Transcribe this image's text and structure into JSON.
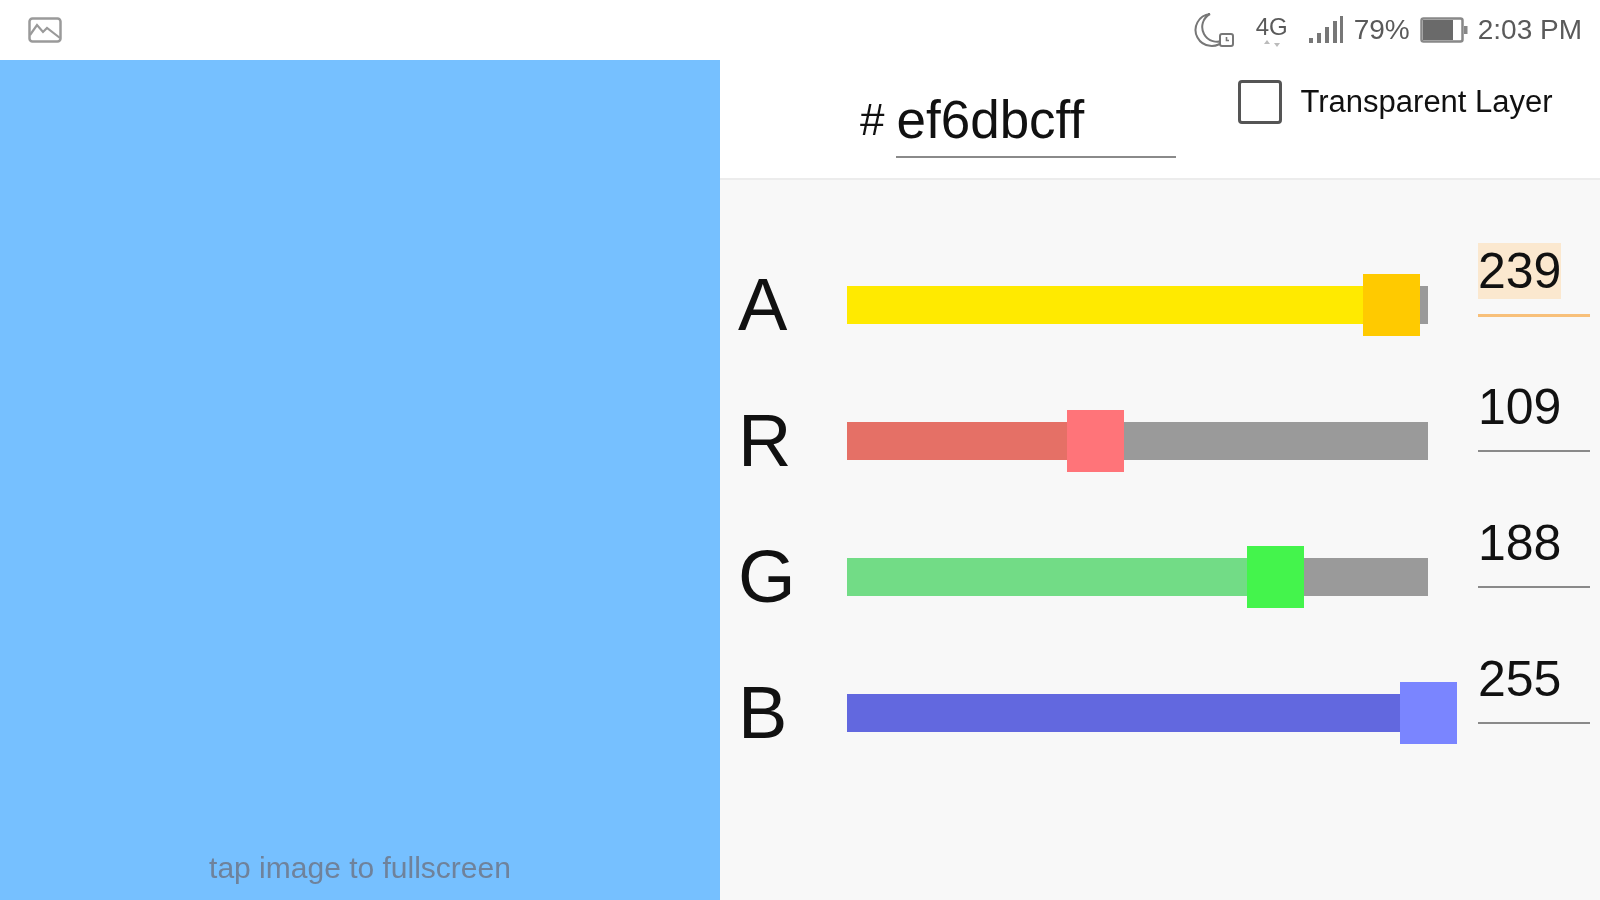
{
  "status_bar": {
    "network": "4G",
    "battery": "79%",
    "time": "2:03 PM"
  },
  "preview": {
    "hint": "tap image to fullscreen"
  },
  "hex_field": {
    "prefix": "#",
    "value": "ef6dbcff"
  },
  "transparent_layer": {
    "label": "Transparent Layer",
    "checked": false
  },
  "channels": [
    {
      "label": "A",
      "level": 0.937,
      "value": "239",
      "focused": true,
      "color": "#ffea00"
    },
    {
      "label": "R",
      "level": 0.427,
      "value": "109",
      "focused": false,
      "color": "#e57066"
    },
    {
      "label": "G",
      "level": 0.737,
      "value": "188",
      "focused": false,
      "color": "#72dc86"
    },
    {
      "label": "B",
      "level": 1.0,
      "value": "255",
      "focused": false,
      "color": "#6268df"
    }
  ]
}
